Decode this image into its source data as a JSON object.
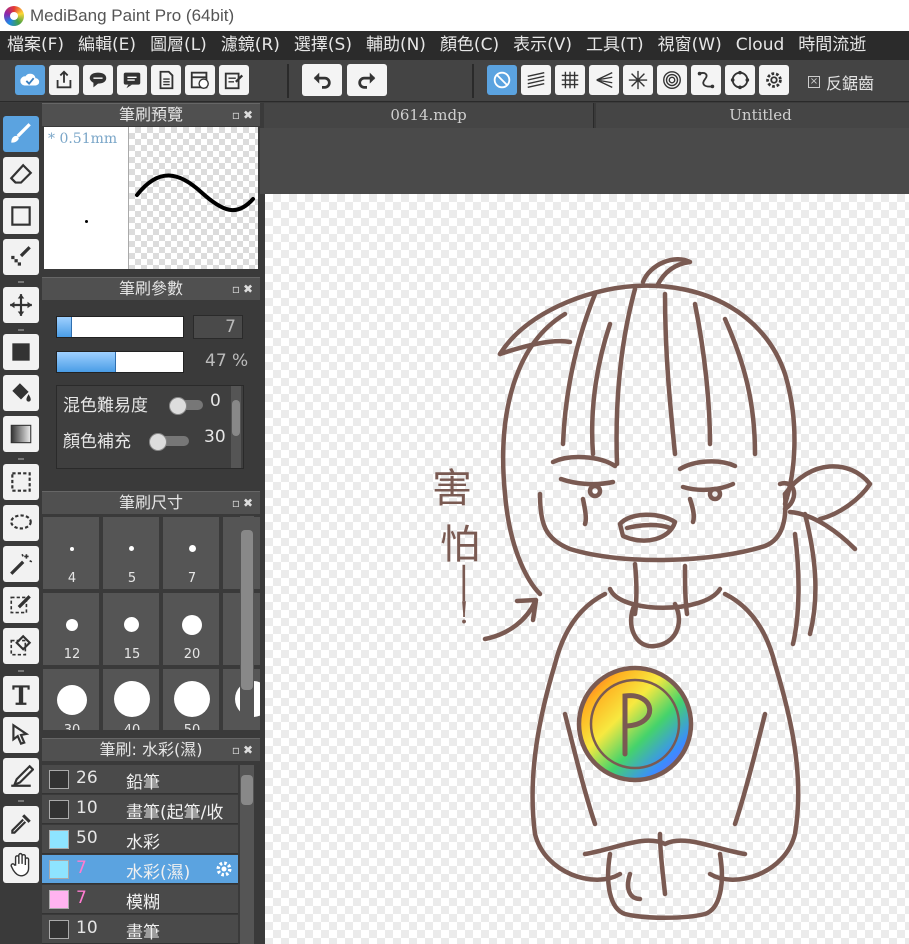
{
  "app": {
    "title": "MediBang Paint Pro (64bit)"
  },
  "menu": [
    "檔案(F)",
    "編輯(E)",
    "圖層(L)",
    "濾鏡(R)",
    "選擇(S)",
    "輔助(N)",
    "顏色(C)",
    "表示(V)",
    "工具(T)",
    "視窗(W)",
    "Cloud",
    "時間流逝"
  ],
  "toolbar": {
    "antialias_label": "反鋸齒"
  },
  "panels": {
    "brush_preview": {
      "title": "筆刷預覽",
      "size_label": "* 0.51mm"
    },
    "brush_params": {
      "title": "筆刷參數",
      "size_value": "7",
      "size_fraction": 0.12,
      "opacity_label": "47 %",
      "opacity_fraction": 0.47,
      "blend_label": "混色難易度",
      "blend_value": "0",
      "fill_label": "顏色補充",
      "fill_value": "30"
    },
    "brush_size": {
      "title": "筆刷尺寸",
      "sizes": [
        "4",
        "5",
        "7",
        "12",
        "15",
        "20",
        "30",
        "40",
        "50"
      ]
    },
    "brush_list": {
      "title": "筆刷: 水彩(濕)",
      "items": [
        {
          "size": "26",
          "name": "鉛筆",
          "color": "#333333",
          "selected": false
        },
        {
          "size": "10",
          "name": "畫筆(起筆/收",
          "color": "#333333",
          "selected": false
        },
        {
          "size": "50",
          "name": "水彩",
          "color": "#8ee4ff",
          "selected": false
        },
        {
          "size": "7",
          "name": "水彩(濕)",
          "color": "#8ee4ff",
          "selected": true
        },
        {
          "size": "7",
          "name": "模糊",
          "color": "#ffb3f0",
          "selected": false
        },
        {
          "size": "10",
          "name": "畫筆",
          "color": "#333333",
          "selected": false
        }
      ]
    }
  },
  "tabs": [
    "0614.mdp",
    "Untitled"
  ],
  "canvas": {
    "handwriting": [
      "害",
      "怕",
      "—",
      "!"
    ],
    "line_color": "#7a5a52"
  },
  "colors": {
    "accent": "#5ba3e0",
    "panel": "#3a3a3a",
    "menubar": "#2b2b2b"
  }
}
